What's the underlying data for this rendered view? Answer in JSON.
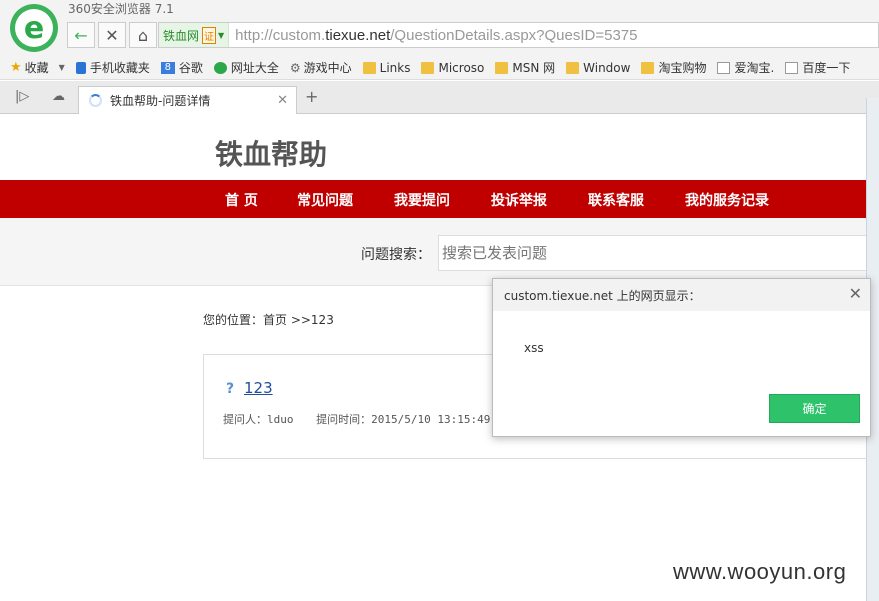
{
  "browser": {
    "app_title": "360安全浏览器 7.1",
    "logo_letter": "e",
    "site_badge": "铁血网",
    "cert_label": "证",
    "url_prefix": "http://custom.",
    "url_domain": "tiexue.net",
    "url_path": "/QuestionDetails.aspx?QuesID=5375"
  },
  "bookmarks": [
    {
      "label": "收藏",
      "icon": "star-icon"
    },
    {
      "label": "手机收藏夹",
      "icon": "phone-icon"
    },
    {
      "label": "谷歌",
      "icon": "google-icon"
    },
    {
      "label": "网址大全",
      "icon": "web-icon"
    },
    {
      "label": "游戏中心",
      "icon": "game-icon"
    },
    {
      "label": "Links",
      "icon": "folder-icon"
    },
    {
      "label": "Microso",
      "icon": "folder-icon"
    },
    {
      "label": "MSN 网",
      "icon": "folder-icon"
    },
    {
      "label": "Window",
      "icon": "folder-icon"
    },
    {
      "label": "淘宝购物",
      "icon": "folder-icon"
    },
    {
      "label": "爱淘宝.",
      "icon": "page-icon"
    },
    {
      "label": "百度一下",
      "icon": "page-icon"
    }
  ],
  "tab": {
    "label": "铁血帮助-问题详情"
  },
  "site": {
    "title": "铁血帮助",
    "nav": [
      "首 页",
      "常见问题",
      "我要提问",
      "投诉举报",
      "联系客服",
      "我的服务记录"
    ],
    "search_label": "问题搜索：",
    "search_placeholder": "搜索已发表问题",
    "breadcrumb": "您的位置：首页 >>123",
    "question_title": "123",
    "question_asker": "提问人：lduo",
    "question_time": "提问时间：2015/5/10 13:15:49"
  },
  "dialog": {
    "title": "custom.tiexue.net 上的网页显示：",
    "message": "xss",
    "ok_label": "确定"
  },
  "watermark": "www.wooyun.org"
}
